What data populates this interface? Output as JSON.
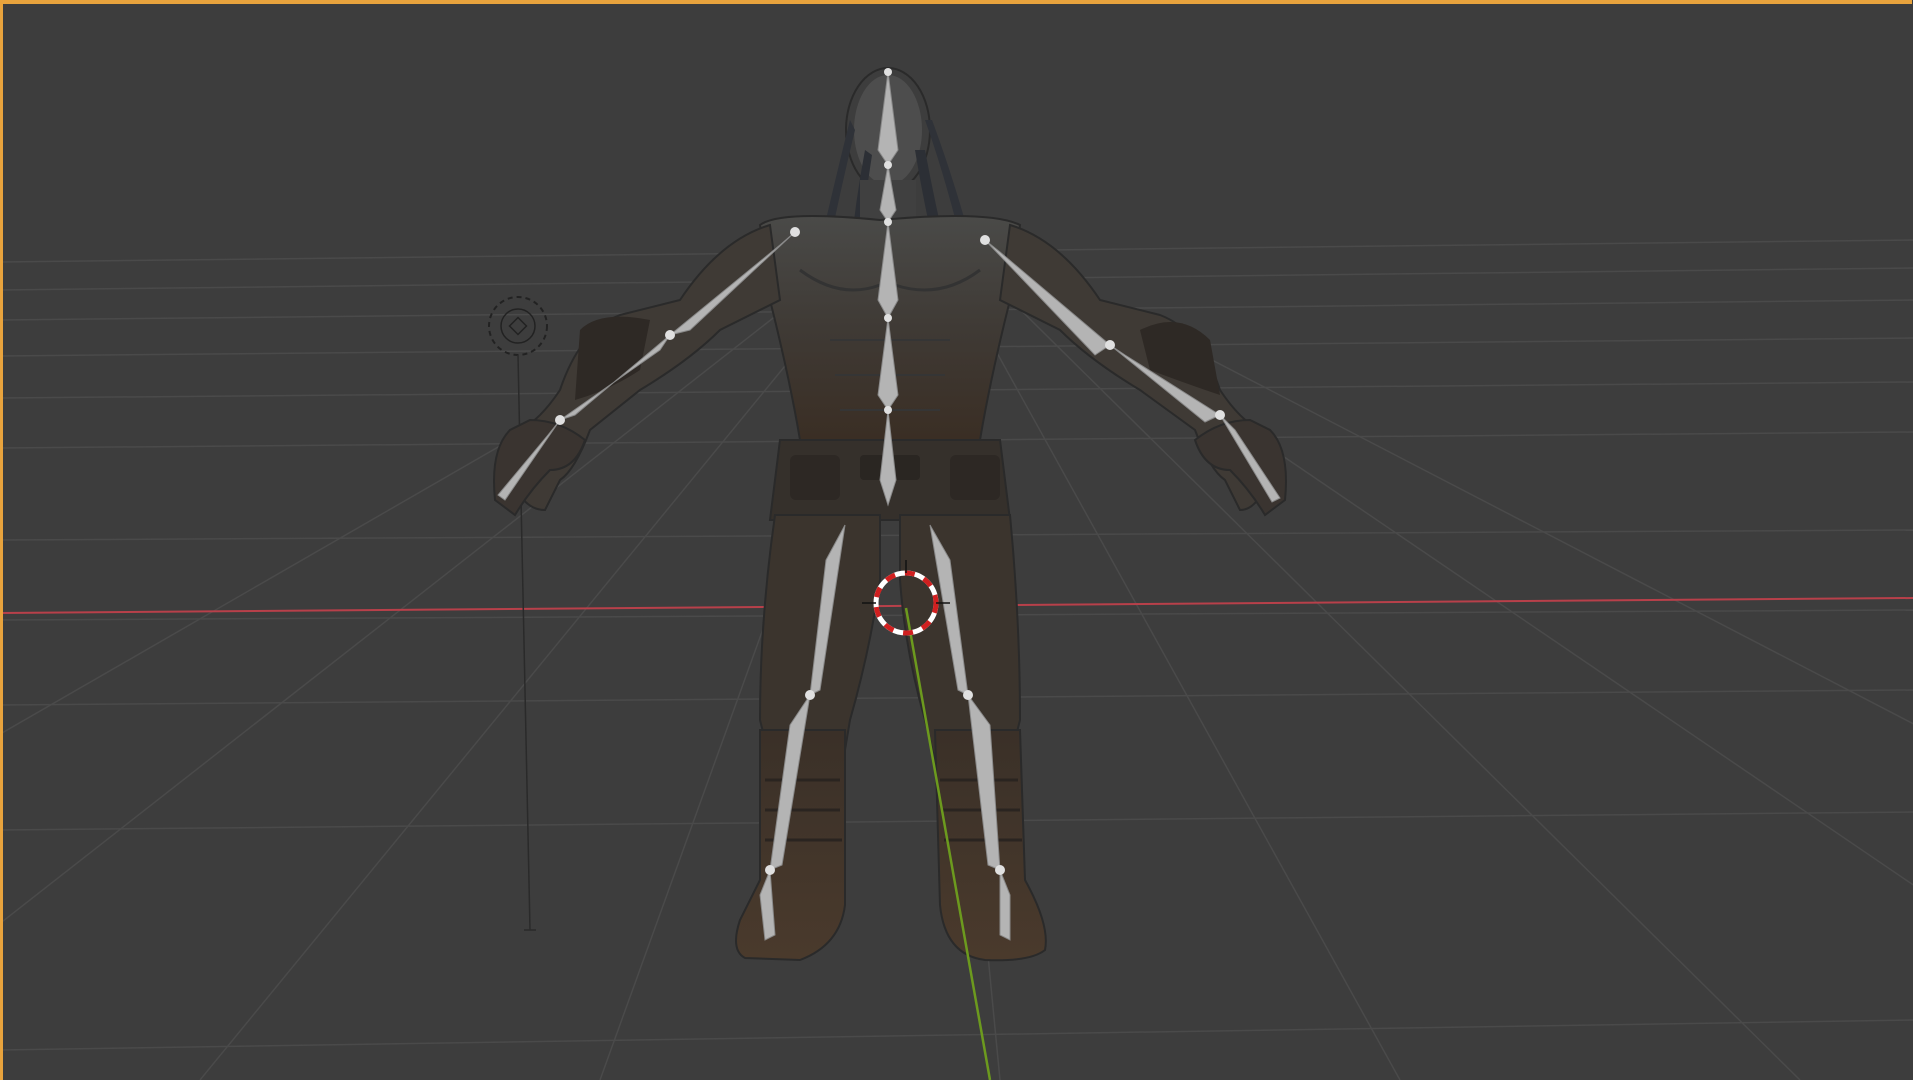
{
  "viewport": {
    "mode": "3d-viewport",
    "background_color": "#3d3d3d",
    "active_border_color": "#e8a33d"
  },
  "grid": {
    "line_color": "#4a4a4a",
    "x_axis_color": "#b8404a",
    "y_axis_color": "#6c9a1e"
  },
  "objects": {
    "character_mesh": {
      "name": "character-mesh",
      "color": "#3e342c"
    },
    "armature": {
      "name": "armature",
      "bone_color": "#b4b4b4"
    },
    "light": {
      "name": "light-object",
      "icon": "light-icon"
    },
    "cursor_3d": {
      "name": "3d-cursor",
      "icon": "crosshair-icon",
      "colors": [
        "#ffffff",
        "#d02020"
      ]
    }
  }
}
